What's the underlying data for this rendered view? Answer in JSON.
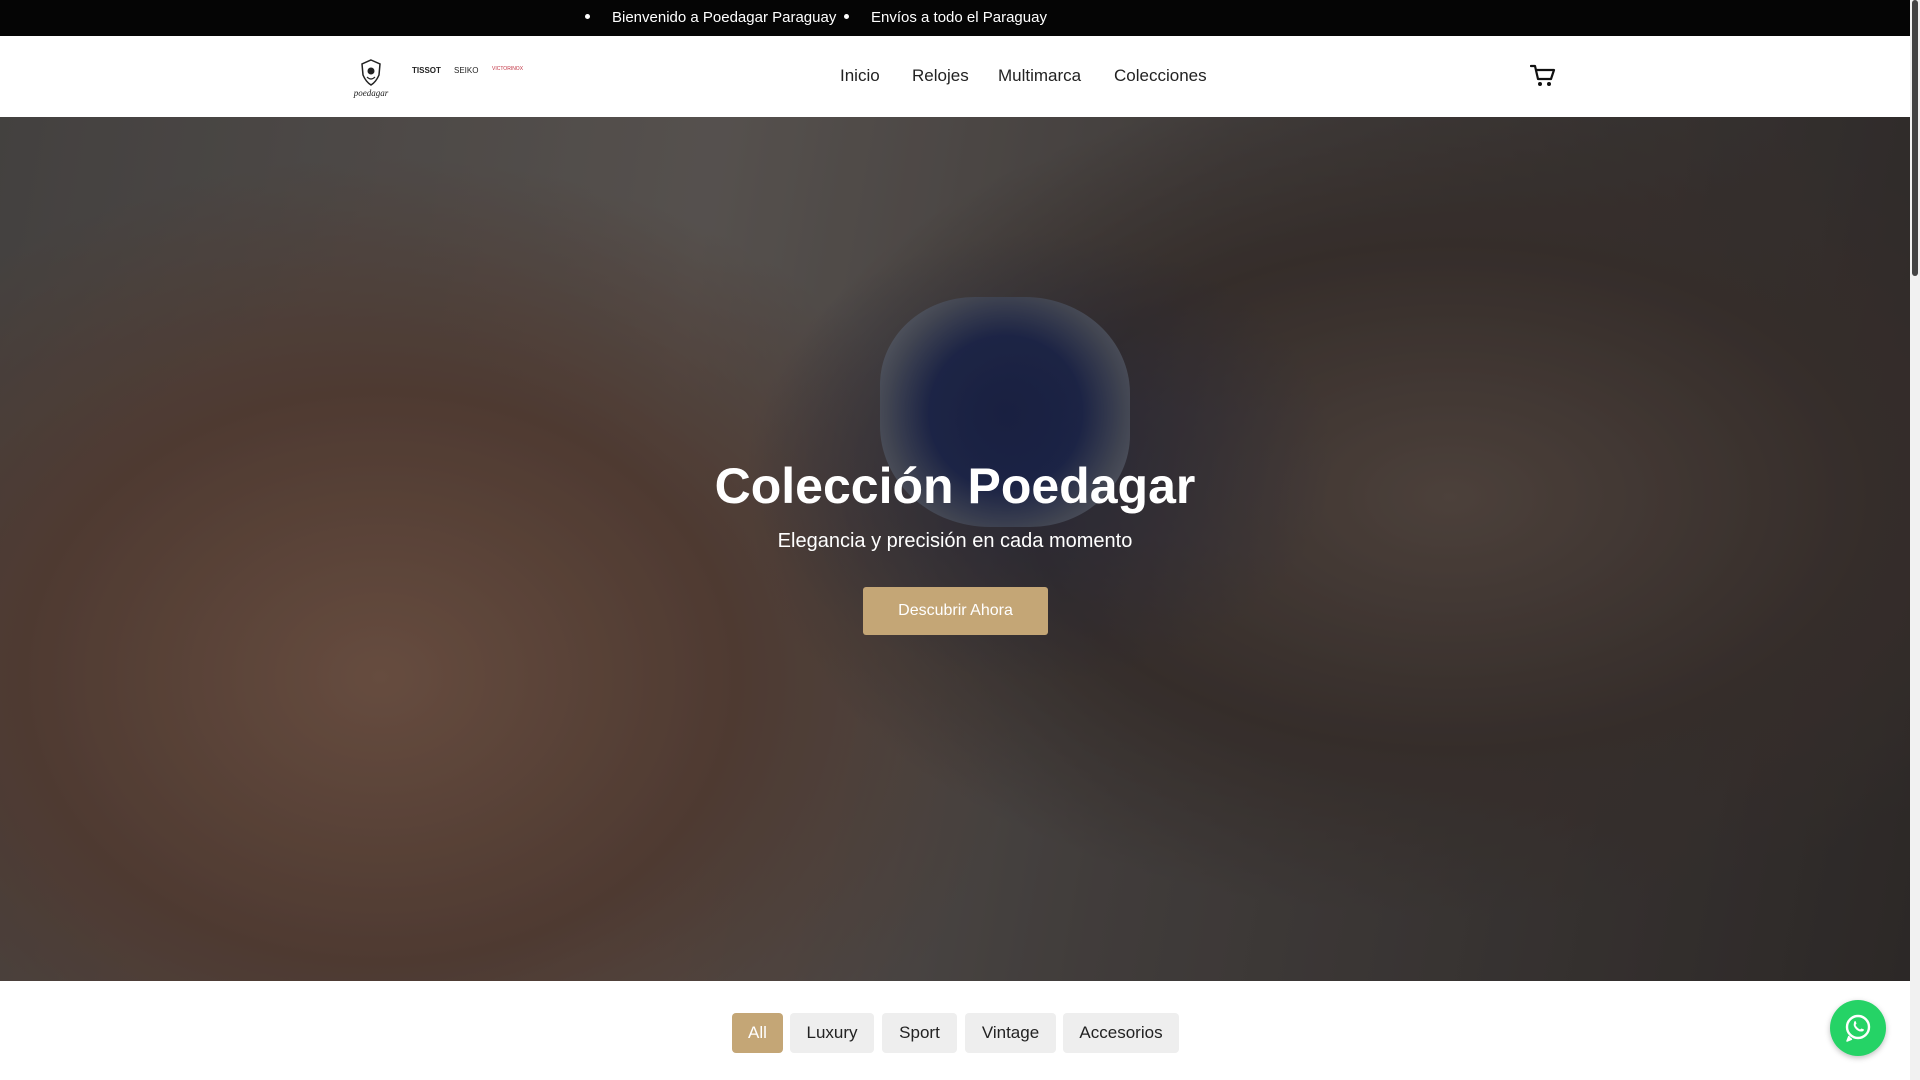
{
  "topbar": {
    "messages": [
      "Bienvenido a Poedagar Paraguay",
      "Envíos a todo el Paraguay"
    ]
  },
  "header": {
    "logo_text": "poedagar",
    "brand_logos": [
      "TISSOT",
      "SEIKO",
      "VICTORINOX"
    ],
    "nav": [
      "Inicio",
      "Relojes",
      "Multimarca",
      "Colecciones"
    ],
    "cart_icon": "cart-icon"
  },
  "hero": {
    "title": "Colección Poedagar",
    "subtitle": "Elegancia y precisión en cada momento",
    "cta": "Descubrir Ahora"
  },
  "filters": {
    "items": [
      "All",
      "Luxury",
      "Sport",
      "Vintage",
      "Accesorios"
    ],
    "active": "All"
  },
  "whatsapp": {
    "icon": "whatsapp-icon"
  },
  "colors": {
    "accent": "#c4a676",
    "topbar": "#050505",
    "whatsapp": "#25d366",
    "filter_bg": "#eeeeee"
  }
}
